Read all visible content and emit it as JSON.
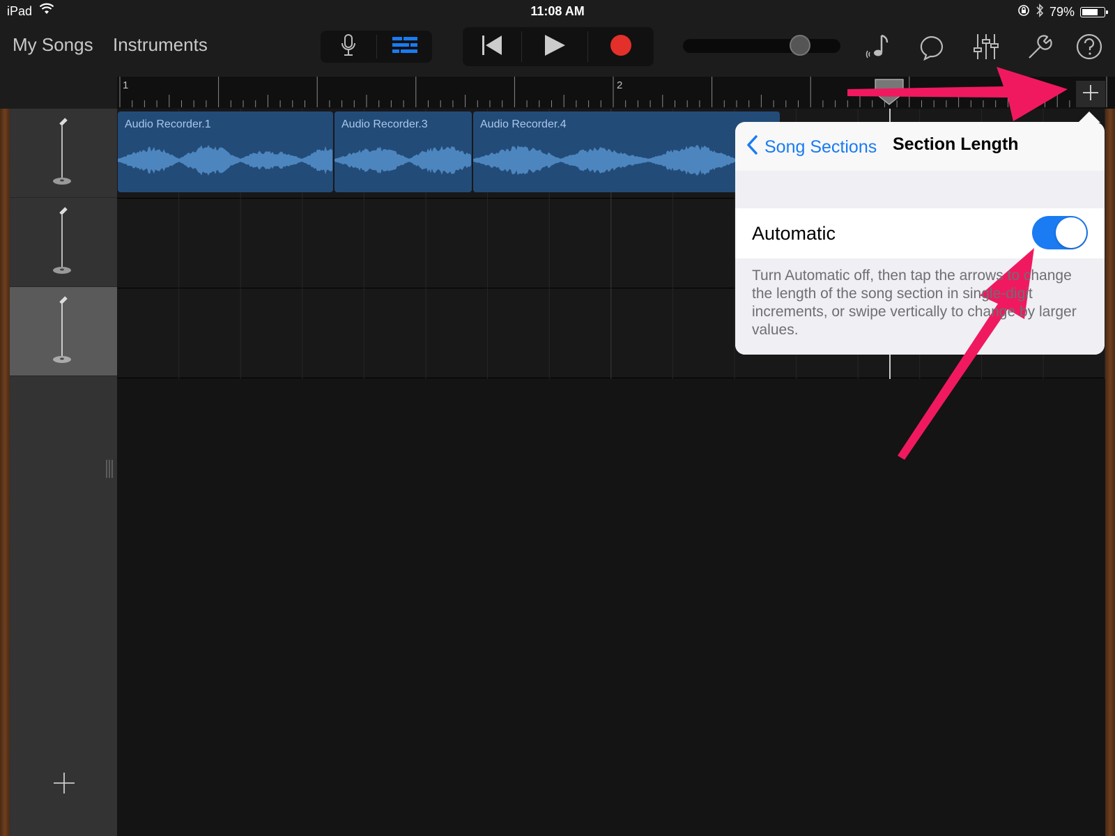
{
  "status_bar": {
    "carrier": "iPad",
    "time": "11:08 AM",
    "battery": "79%",
    "battery_level": 0.79
  },
  "toolbar": {
    "nav": [
      "My Songs",
      "Instruments"
    ],
    "view_buttons": [
      "microphone-icon",
      "tracks-view-icon"
    ],
    "transport": [
      "rewind-icon",
      "play-icon",
      "record-icon"
    ],
    "master_volume_level": 0.78,
    "tools": [
      "metronome-icon",
      "loop-browser-icon",
      "mixer-icon",
      "settings-icon",
      "help-icon"
    ],
    "accent_color": "#1a7bf2",
    "record_color": "#e3302b"
  },
  "ruler": {
    "bars": [
      "1",
      "2"
    ]
  },
  "regions": [
    {
      "label": "Audio Recorder.1"
    },
    {
      "label": "Audio Recorder.3"
    },
    {
      "label": "Audio Recorder.4"
    }
  ],
  "tracks": [
    {
      "instrument": "microphone-stand-icon"
    },
    {
      "instrument": "microphone-stand-icon"
    },
    {
      "instrument": "microphone-stand-icon"
    }
  ],
  "popover": {
    "back_label": "Song Sections",
    "title": "Section Length",
    "row_label": "Automatic",
    "toggle_on": true,
    "description": "Turn Automatic off, then tap the arrows to change the length of the song section in single-digit increments, or swipe vertically to change by larger values."
  },
  "annotation_color": "#f0195f"
}
